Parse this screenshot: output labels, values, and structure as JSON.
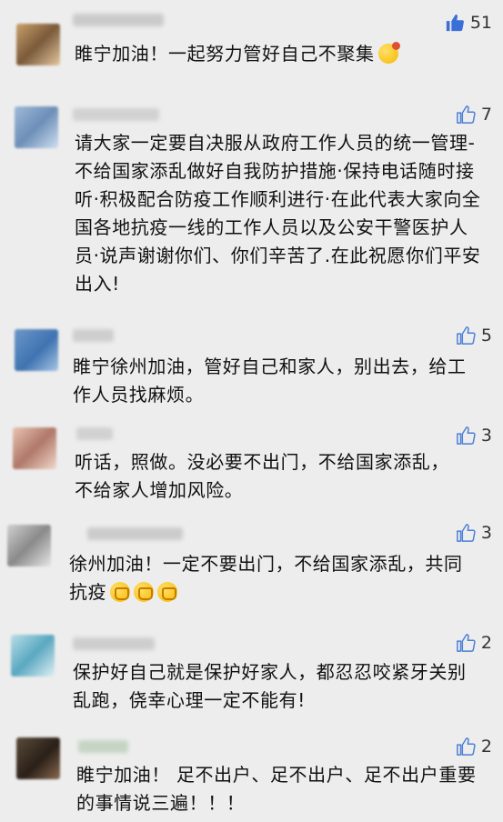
{
  "icons": {
    "like_outline": "thumbs-up-outline-icon",
    "like_filled": "thumbs-up-filled-icon"
  },
  "colors": {
    "like_filled": "#3b6fd8",
    "like_outline": "#4b7fd6"
  },
  "comments": [
    {
      "likes": "51",
      "liked": true,
      "text": "睢宁加油！一起努力管好自己不聚集",
      "emoji": [
        "shushing-face-emoji"
      ]
    },
    {
      "likes": "7",
      "liked": false,
      "text": "请大家一定要自决服从政府工作人员的统一管理-不给国家添乱做好自我防护措施·保持电话随时接听·积极配合防疫工作顺利进行·在此代表大家向全国各地抗疫一线的工作人员以及公安干警医护人员·说声谢谢你们、你们辛苦了.在此祝愿你们平安出入!",
      "emoji": []
    },
    {
      "likes": "5",
      "liked": false,
      "text": "睢宁徐州加油，管好自己和家人，别出去，给工作人员找麻烦。",
      "emoji": []
    },
    {
      "likes": "3",
      "liked": false,
      "text": "听话，照做。没必要不出门，不给国家添乱，不给家人增加风险。",
      "emoji": []
    },
    {
      "likes": "3",
      "liked": false,
      "text": "徐州加油！一定不要出门，不给国家添乱，共同抗疫",
      "emoji": [
        "fist-emoji",
        "fist-emoji",
        "fist-emoji"
      ]
    },
    {
      "likes": "2",
      "liked": false,
      "text": "保护好自己就是保护好家人，都忍忍咬紧牙关别乱跑，侥幸心理一定不能有!",
      "emoji": []
    },
    {
      "likes": "2",
      "liked": false,
      "text": "睢宁加油！ 足不出户、足不出户、足不出户重要的事情说三遍！！！",
      "emoji": []
    }
  ]
}
